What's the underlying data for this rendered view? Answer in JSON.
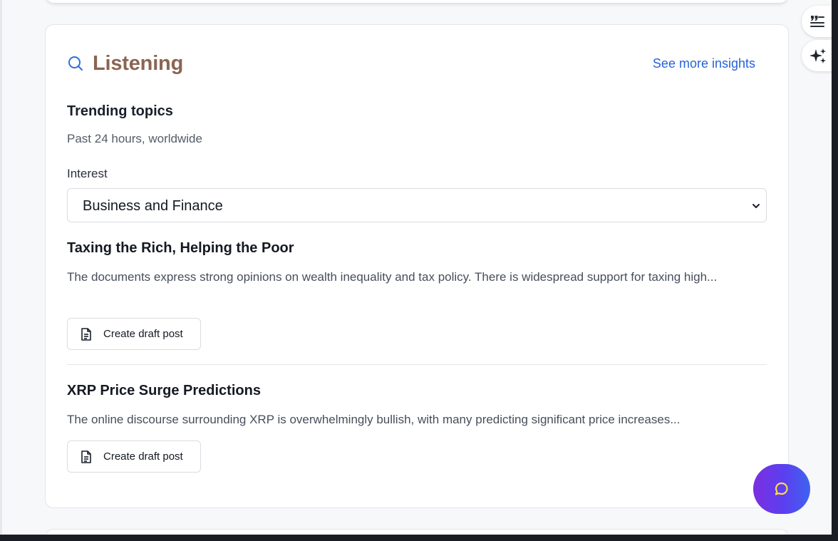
{
  "listening": {
    "title": "Listening",
    "see_more_label": "See more insights",
    "trending": {
      "heading": "Trending topics",
      "subtitle": "Past 24 hours, worldwide"
    },
    "interest": {
      "label": "Interest",
      "selected": "Business and Finance"
    },
    "topics": [
      {
        "title": "Taxing the Rich, Helping the Poor",
        "description": "The documents express strong opinions on wealth inequality and tax policy. There is widespread support for taxing high...",
        "action_label": "Create draft post"
      },
      {
        "title": "XRP Price Surge Predictions",
        "description": "The online discourse surrounding XRP is overwhelmingly bullish, with many predicting significant price increases...",
        "action_label": "Create draft post"
      }
    ]
  },
  "icons": {
    "title": "search-icon",
    "select": "chevron-down-icon",
    "draft": "document-icon",
    "side_top": "quote-list-icon",
    "side_bottom": "sparkle-icon",
    "fab": "chat-bubble-icon"
  },
  "colors": {
    "title": "#8a6553",
    "link": "#2762d8",
    "fab_start": "#7b2fe0",
    "fab_end": "#3f63ef"
  }
}
